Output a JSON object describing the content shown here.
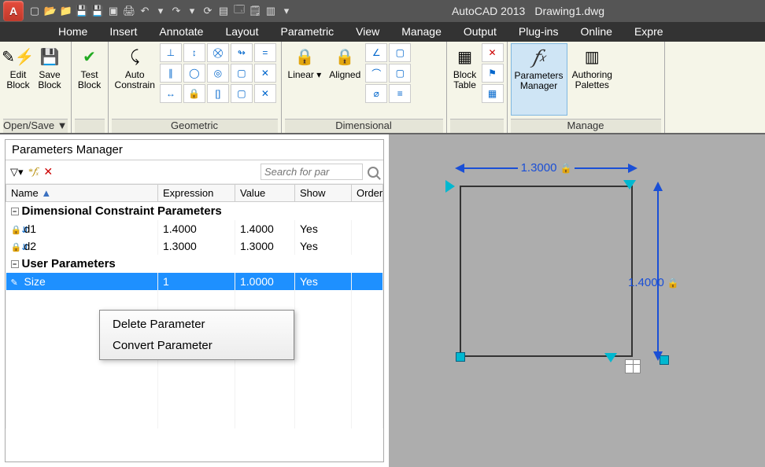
{
  "app": {
    "title": "AutoCAD 2013",
    "file": "Drawing1.dwg"
  },
  "menus": [
    "Home",
    "Insert",
    "Annotate",
    "Layout",
    "Parametric",
    "View",
    "Manage",
    "Output",
    "Plug-ins",
    "Online",
    "Expre"
  ],
  "ribbon": {
    "groups": [
      {
        "label": "Open/Save ▼",
        "buttons": [
          {
            "name": "edit-block",
            "label": "Edit\nBlock",
            "icon": "✎⚡"
          },
          {
            "name": "save-block",
            "label": "Save\nBlock",
            "icon": "💾"
          }
        ]
      },
      {
        "label": "",
        "buttons": [
          {
            "name": "test-block",
            "label": "Test\nBlock",
            "icon": "✔"
          }
        ]
      },
      {
        "label": "Geometric",
        "buttons": [
          {
            "name": "auto-constrain",
            "label": "Auto\nConstrain",
            "icon": "⤹✎"
          }
        ]
      },
      {
        "label": "Dimensional",
        "buttons": [
          {
            "name": "linear",
            "label": "Linear ▾",
            "icon": "🔒↔"
          },
          {
            "name": "aligned",
            "label": "Aligned",
            "icon": "🔒⤢"
          }
        ]
      },
      {
        "label": "",
        "buttons": [
          {
            "name": "block-table",
            "label": "Block\nTable",
            "icon": "▦"
          }
        ]
      },
      {
        "label": "Manage",
        "buttons": [
          {
            "name": "parameters-manager",
            "label": "Parameters\nManager",
            "icon": "𝑓ₓ",
            "active": true
          },
          {
            "name": "authoring-palettes",
            "label": "Authoring\nPalettes",
            "icon": "▥"
          }
        ]
      }
    ]
  },
  "panel": {
    "title": "Parameters Manager",
    "search_ph": "Search for par",
    "cols": [
      "Name",
      "Expression",
      "Value",
      "Show",
      "Order"
    ],
    "sec1": "Dimensional Constraint Parameters",
    "rows1": [
      {
        "name": "d1",
        "expr": "1.4000",
        "val": "1.4000",
        "show": "Yes"
      },
      {
        "name": "d2",
        "expr": "1.3000",
        "val": "1.3000",
        "show": "Yes"
      }
    ],
    "sec2": "User Parameters",
    "rows2": [
      {
        "name": "Size",
        "expr": "1",
        "val": "1.0000",
        "show": "Yes",
        "sel": true
      }
    ]
  },
  "ctx": {
    "items": [
      "Delete Parameter",
      "Convert Parameter"
    ]
  },
  "canvas": {
    "dim_h": "1.3000",
    "dim_v": "1.4000"
  }
}
